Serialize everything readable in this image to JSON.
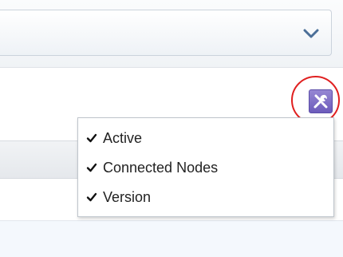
{
  "toolbar": {
    "dropdown_icon": "chevron-down-icon",
    "settings_icon": "tools-icon",
    "accent_color": "#7b6bc6",
    "highlight_color": "#e02020"
  },
  "column_menu": {
    "items": [
      {
        "label": "Active",
        "checked": true,
        "icon": "check-icon"
      },
      {
        "label": "Connected Nodes",
        "checked": true,
        "icon": "check-icon"
      },
      {
        "label": "Version",
        "checked": true,
        "icon": "check-icon"
      }
    ]
  }
}
